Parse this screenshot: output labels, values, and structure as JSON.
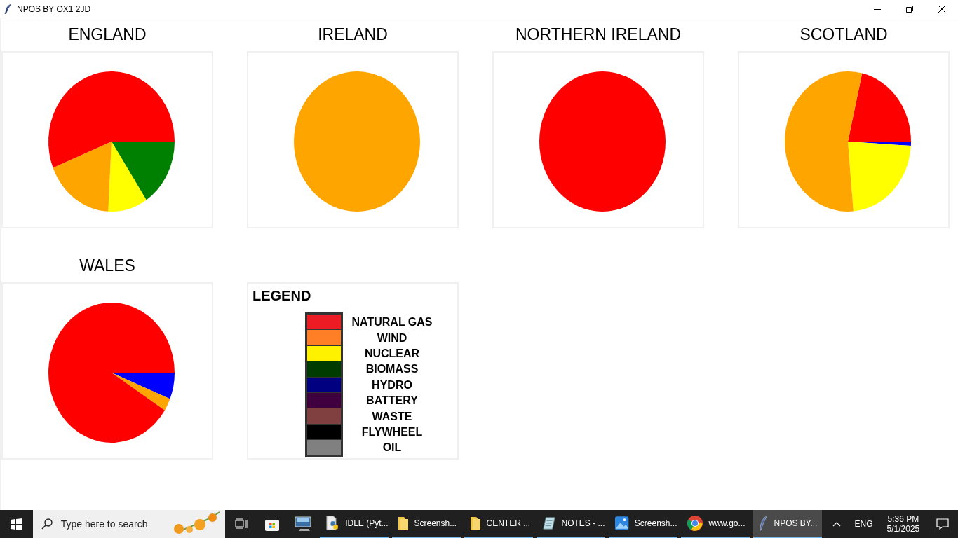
{
  "window": {
    "title": "NPOS BY OX1 2JD"
  },
  "charts": [
    {
      "title": "ENGLAND"
    },
    {
      "title": "IRELAND"
    },
    {
      "title": "NORTHERN IRELAND"
    },
    {
      "title": "SCOTLAND"
    },
    {
      "title": "WALES"
    }
  ],
  "legend": {
    "title": "LEGEND",
    "items": [
      {
        "label": "NATURAL GAS",
        "color": "#ed1c24"
      },
      {
        "label": "WIND",
        "color": "#ff7f27"
      },
      {
        "label": "NUCLEAR",
        "color": "#fff200"
      },
      {
        "label": "BIOMASS",
        "color": "#003b00"
      },
      {
        "label": "HYDRO",
        "color": "#000080"
      },
      {
        "label": "BATTERY",
        "color": "#400040"
      },
      {
        "label": "WASTE",
        "color": "#804040"
      },
      {
        "label": "FLYWHEEL",
        "color": "#000000"
      },
      {
        "label": "OIL",
        "color": "#808080"
      }
    ]
  },
  "taskbar": {
    "search": {
      "placeholder": "Type here to search"
    },
    "apps": [
      {
        "kind": "python",
        "label": "IDLE (Pyt...",
        "selected": false
      },
      {
        "kind": "folder",
        "label": "Screensh...",
        "selected": false
      },
      {
        "kind": "folder",
        "label": "CENTER ...",
        "selected": false
      },
      {
        "kind": "notepad",
        "label": "NOTES - ...",
        "selected": false
      },
      {
        "kind": "photos",
        "label": "Screensh...",
        "selected": false
      },
      {
        "kind": "browser",
        "label": "www.go...",
        "selected": false
      },
      {
        "kind": "feather",
        "label": "NPOS BY...",
        "selected": true
      }
    ],
    "language": "ENG",
    "time": "5:36 PM",
    "date": "5/1/2025"
  }
}
